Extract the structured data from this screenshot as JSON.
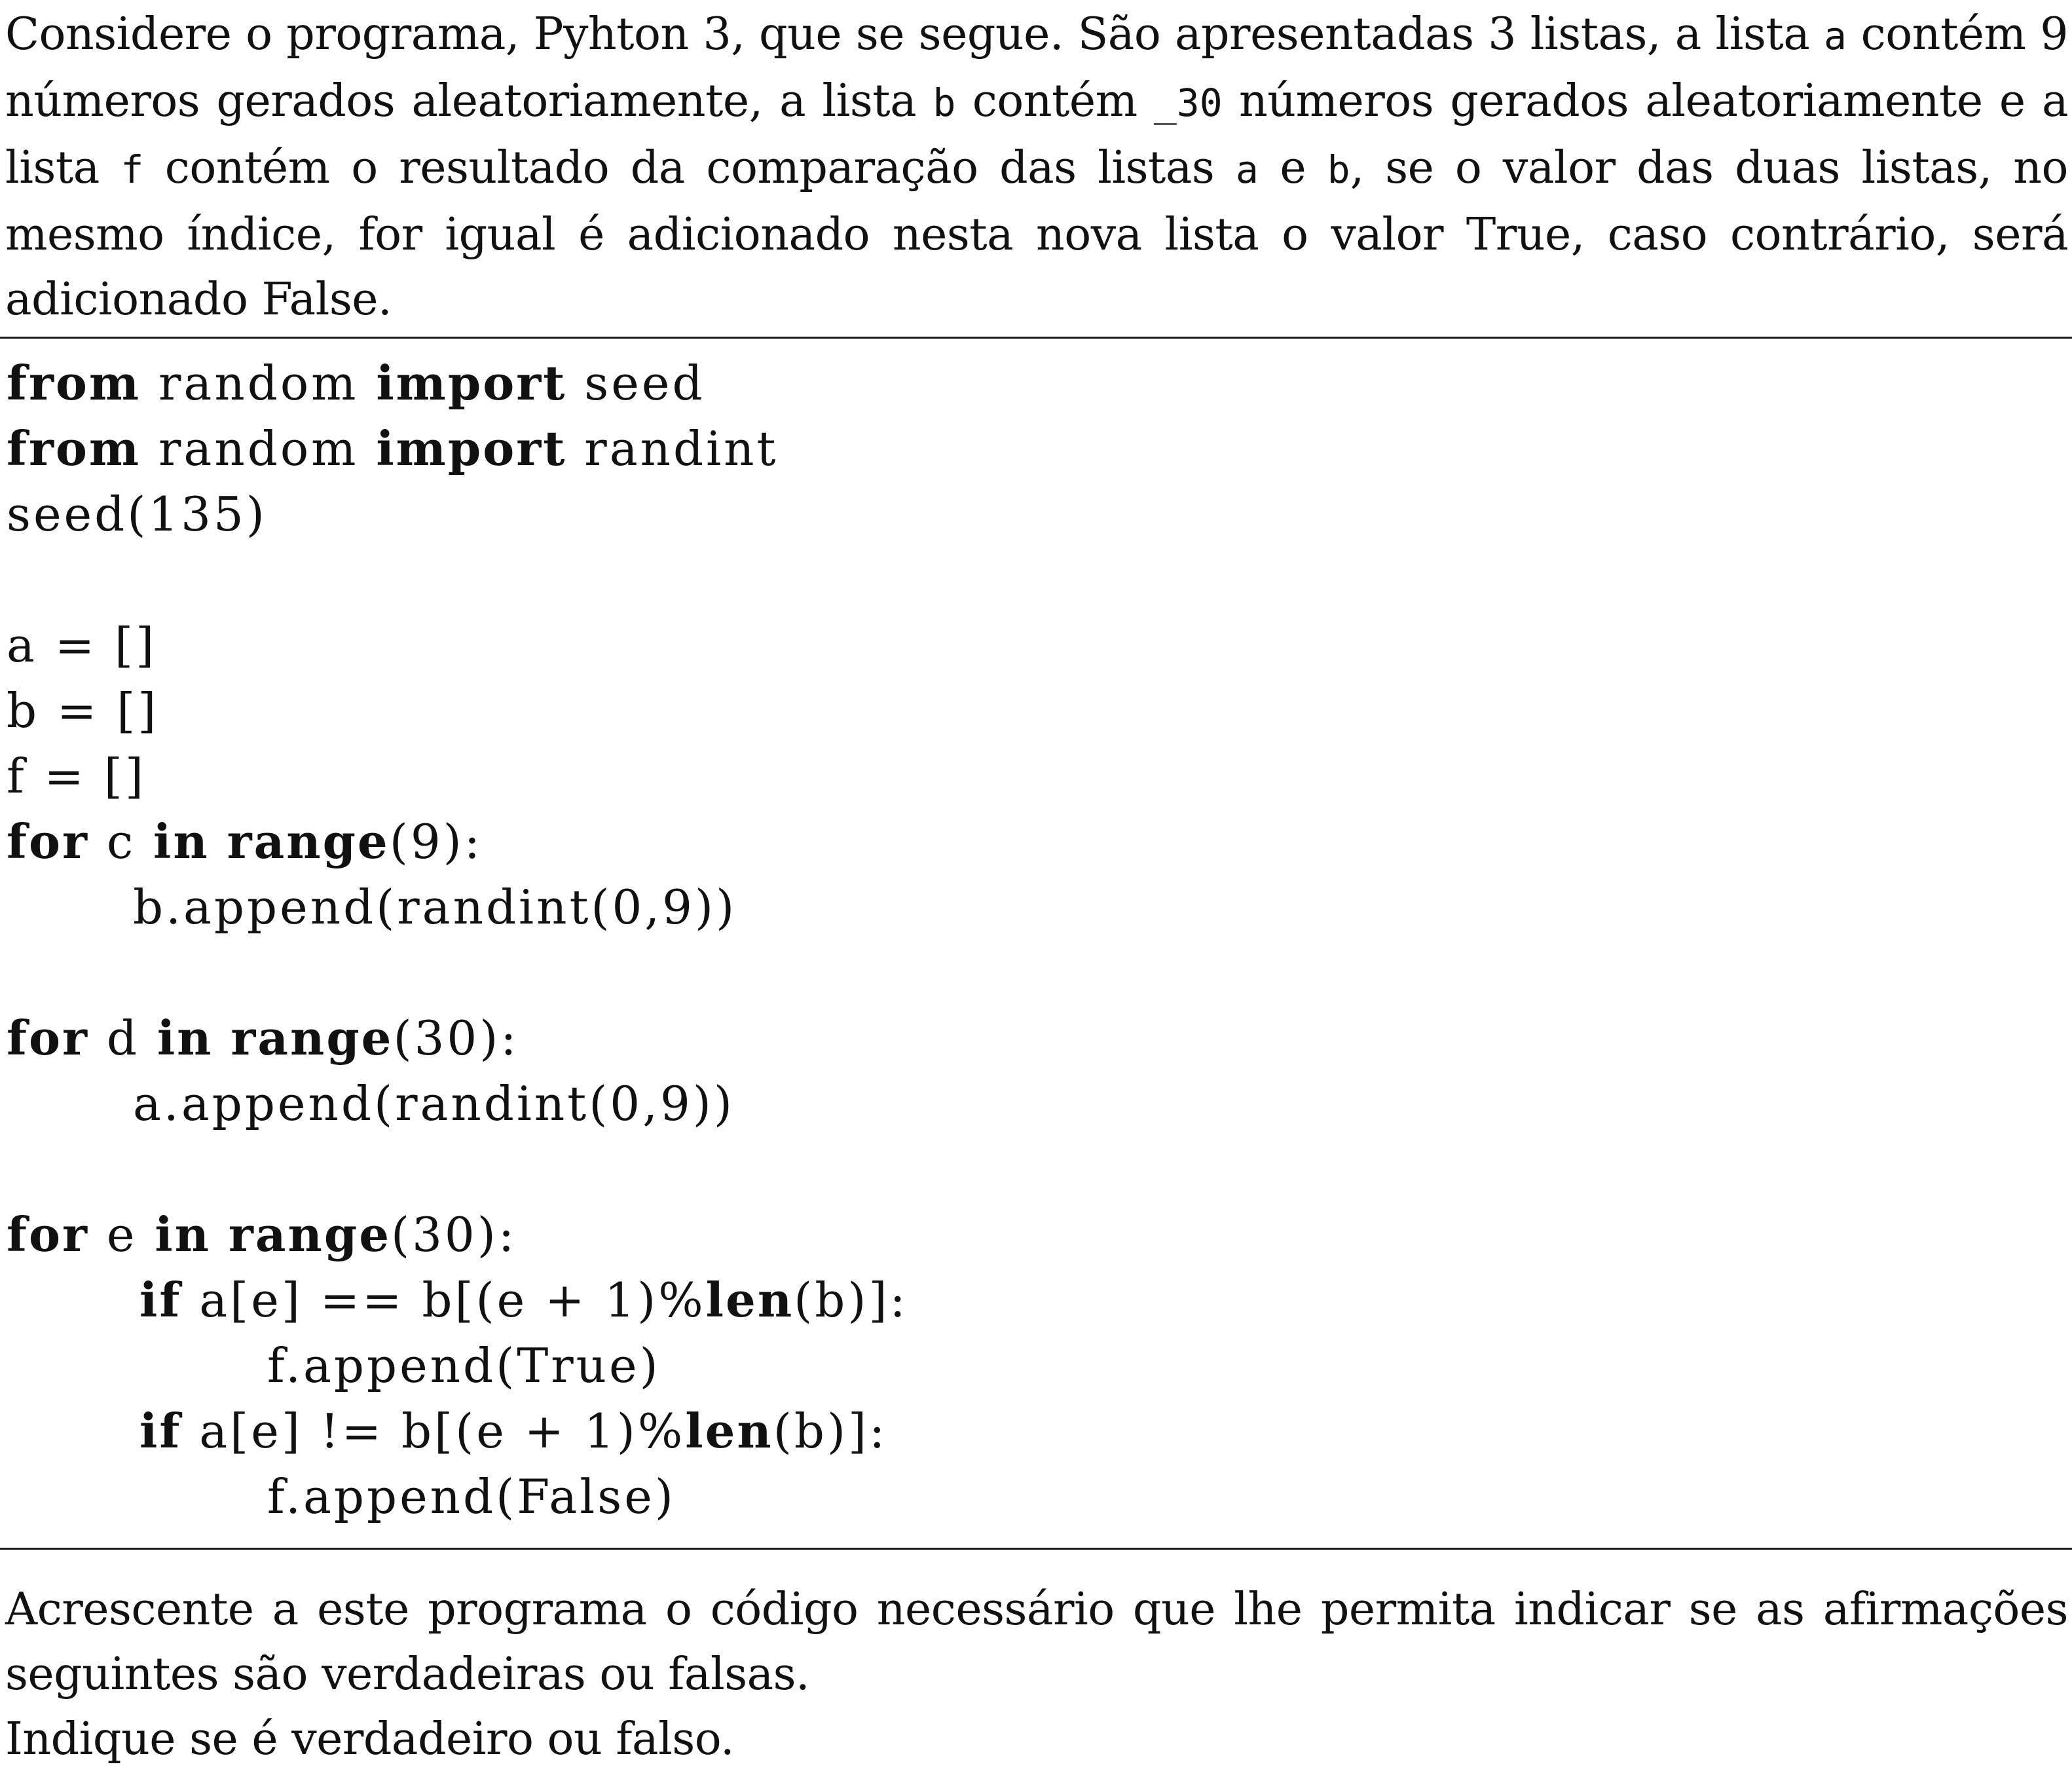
{
  "intro": {
    "part1": "Considere o programa, Pyhton 3, que se segue. São apresentadas 3 listas, a lista ",
    "var_a": "a",
    "part2": " contém 9 números gerados aleatoriamente, a lista ",
    "var_b": "b",
    "part3": " contém ",
    "count_b": "_30",
    "part4": " números gerados aleatoriamente e a lista ",
    "var_f": "f",
    "part5": " contém o resultado da comparação das listas ",
    "var_a2": "a",
    "part6": " e ",
    "var_b2": "b",
    "part7": ", se o valor das duas listas, no mesmo índice, for igual é adicionado nesta nova lista o valor True, caso contrário, será adicionado False."
  },
  "code": {
    "l1_kw1": "from",
    "l1_t1": " random ",
    "l1_kw2": "import",
    "l1_t2": " seed",
    "l2_kw1": "from",
    "l2_t1": " random ",
    "l2_kw2": "import",
    "l2_t2": " randint",
    "l3_t": "seed(135)",
    "l5_t": "a = []",
    "l6_t": "b = []",
    "l7_t": "f = []",
    "l8_kw1": "for",
    "l8_t1": " c ",
    "l8_kw2": "in",
    "l8_t2": " ",
    "l8_kw3": "range",
    "l8_t3": "(9):",
    "l9_t": "b.append(randint(0,9))",
    "l11_kw1": "for",
    "l11_t1": " d ",
    "l11_kw2": "in",
    "l11_t2": " ",
    "l11_kw3": "range",
    "l11_t3": "(30):",
    "l12_t": "a.append(randint(0,9))",
    "l14_kw1": "for",
    "l14_t1": " e ",
    "l14_kw2": "in",
    "l14_t2": " ",
    "l14_kw3": "range",
    "l14_t3": "(30):",
    "l15_kw1": "if",
    "l15_t1": " a[e] == b[(e + 1)%",
    "l15_kw2": "len",
    "l15_t2": "(b)]:",
    "l16_t": "f.append(True)",
    "l17_kw1": "if",
    "l17_t1": " a[e] != b[(e + 1)%",
    "l17_kw2": "len",
    "l17_t2": "(b)]:",
    "l18_t": "f.append(False)"
  },
  "outro": {
    "line1": "Acrescente a este programa o código necessário que lhe permita indicar se as afirmações seguintes são verdadeiras ou falsas.",
    "line2": "Indique se é verdadeiro ou falso."
  }
}
